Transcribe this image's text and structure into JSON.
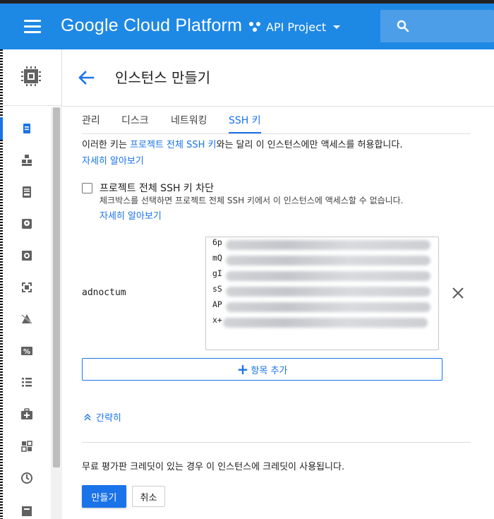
{
  "header": {
    "app_title": "Google Cloud Platform",
    "project_name": "API Project",
    "colors": {
      "bar": "#1e88e5",
      "search": "#4d9ee9"
    }
  },
  "rail": {
    "head_icon": "compute-engine-chip-icon",
    "items": [
      {
        "icon": "vm-instances-icon",
        "active": true
      },
      {
        "icon": "instance-groups-icon",
        "active": false
      },
      {
        "icon": "instance-templates-icon",
        "active": false
      },
      {
        "icon": "disks-icon",
        "active": false
      },
      {
        "icon": "snapshots-icon",
        "active": false
      },
      {
        "icon": "images-icon",
        "active": false
      },
      {
        "icon": "tpus-icon",
        "active": false
      },
      {
        "icon": "committed-use-discounts-icon",
        "active": false
      },
      {
        "icon": "metadata-icon",
        "active": false
      },
      {
        "icon": "health-checks-icon",
        "active": false
      },
      {
        "icon": "zones-icon",
        "active": false
      },
      {
        "icon": "operations-icon",
        "active": false
      },
      {
        "icon": "settings-icon",
        "active": false
      }
    ]
  },
  "page": {
    "title": "인스턴스 만들기",
    "tabs": [
      {
        "label": "관리",
        "active": false
      },
      {
        "label": "디스크",
        "active": false
      },
      {
        "label": "네트워킹",
        "active": false
      },
      {
        "label": "SSH 키",
        "active": true
      }
    ]
  },
  "ssh": {
    "intro_before": "이러한 키는 ",
    "intro_link": "프로젝트 전체 SSH 키",
    "intro_after": "와는 달리 이 인스턴스에만 액세스를 허용합니다.",
    "learn_more": "자세히 알아보기",
    "block_label": "프로젝트 전체 SSH 키 차단",
    "block_checked": false,
    "block_desc": "체크박스를 선택하면 프로젝트 전체 SSH 키에서 이 인스턴스에 액세스할 수 없습니다.",
    "block_learn_more": "자세히 알아보기",
    "username": "adnoctum",
    "key_prefixes": [
      "6p",
      "mQ",
      "gI",
      "sS",
      "AP",
      "x+"
    ],
    "add_item": "항목 추가",
    "collapse": "간략히"
  },
  "footer": {
    "credit_text": "무료 평가판 크레딧이 있는 경우 이 인스턴스에 크레딧이 사용됩니다.",
    "create_label": "만들기",
    "cancel_label": "취소"
  }
}
